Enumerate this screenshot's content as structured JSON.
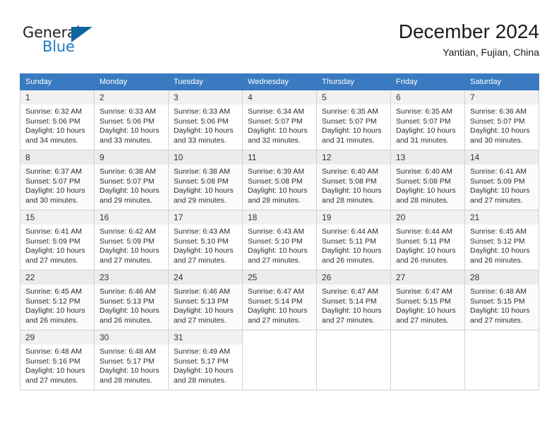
{
  "brand": {
    "name_part1": "General",
    "name_part2": "Blue",
    "triangle_color": "#10659f",
    "blue_color": "#1f7bc1"
  },
  "header": {
    "title": "December 2024",
    "subtitle": "Yantian, Fujian, China"
  },
  "theme": {
    "header_bg": "#3a7ac0",
    "header_text": "#ffffff",
    "cell_border": "#d2d2d2",
    "daynum_bg": "#f1f1f1"
  },
  "weekdays": [
    "Sunday",
    "Monday",
    "Tuesday",
    "Wednesday",
    "Thursday",
    "Friday",
    "Saturday"
  ],
  "labels": {
    "sunrise_prefix": "Sunrise:",
    "sunset_prefix": "Sunset:",
    "daylight_prefix": "Daylight:"
  },
  "weeks": [
    [
      {
        "day": "1",
        "sunrise": "Sunrise: 6:32 AM",
        "sunset": "Sunset: 5:06 PM",
        "daylight": "Daylight: 10 hours and 34 minutes."
      },
      {
        "day": "2",
        "sunrise": "Sunrise: 6:33 AM",
        "sunset": "Sunset: 5:06 PM",
        "daylight": "Daylight: 10 hours and 33 minutes."
      },
      {
        "day": "3",
        "sunrise": "Sunrise: 6:33 AM",
        "sunset": "Sunset: 5:06 PM",
        "daylight": "Daylight: 10 hours and 33 minutes."
      },
      {
        "day": "4",
        "sunrise": "Sunrise: 6:34 AM",
        "sunset": "Sunset: 5:07 PM",
        "daylight": "Daylight: 10 hours and 32 minutes."
      },
      {
        "day": "5",
        "sunrise": "Sunrise: 6:35 AM",
        "sunset": "Sunset: 5:07 PM",
        "daylight": "Daylight: 10 hours and 31 minutes."
      },
      {
        "day": "6",
        "sunrise": "Sunrise: 6:35 AM",
        "sunset": "Sunset: 5:07 PM",
        "daylight": "Daylight: 10 hours and 31 minutes."
      },
      {
        "day": "7",
        "sunrise": "Sunrise: 6:36 AM",
        "sunset": "Sunset: 5:07 PM",
        "daylight": "Daylight: 10 hours and 30 minutes."
      }
    ],
    [
      {
        "day": "8",
        "sunrise": "Sunrise: 6:37 AM",
        "sunset": "Sunset: 5:07 PM",
        "daylight": "Daylight: 10 hours and 30 minutes."
      },
      {
        "day": "9",
        "sunrise": "Sunrise: 6:38 AM",
        "sunset": "Sunset: 5:07 PM",
        "daylight": "Daylight: 10 hours and 29 minutes."
      },
      {
        "day": "10",
        "sunrise": "Sunrise: 6:38 AM",
        "sunset": "Sunset: 5:08 PM",
        "daylight": "Daylight: 10 hours and 29 minutes."
      },
      {
        "day": "11",
        "sunrise": "Sunrise: 6:39 AM",
        "sunset": "Sunset: 5:08 PM",
        "daylight": "Daylight: 10 hours and 28 minutes."
      },
      {
        "day": "12",
        "sunrise": "Sunrise: 6:40 AM",
        "sunset": "Sunset: 5:08 PM",
        "daylight": "Daylight: 10 hours and 28 minutes."
      },
      {
        "day": "13",
        "sunrise": "Sunrise: 6:40 AM",
        "sunset": "Sunset: 5:08 PM",
        "daylight": "Daylight: 10 hours and 28 minutes."
      },
      {
        "day": "14",
        "sunrise": "Sunrise: 6:41 AM",
        "sunset": "Sunset: 5:09 PM",
        "daylight": "Daylight: 10 hours and 27 minutes."
      }
    ],
    [
      {
        "day": "15",
        "sunrise": "Sunrise: 6:41 AM",
        "sunset": "Sunset: 5:09 PM",
        "daylight": "Daylight: 10 hours and 27 minutes."
      },
      {
        "day": "16",
        "sunrise": "Sunrise: 6:42 AM",
        "sunset": "Sunset: 5:09 PM",
        "daylight": "Daylight: 10 hours and 27 minutes."
      },
      {
        "day": "17",
        "sunrise": "Sunrise: 6:43 AM",
        "sunset": "Sunset: 5:10 PM",
        "daylight": "Daylight: 10 hours and 27 minutes."
      },
      {
        "day": "18",
        "sunrise": "Sunrise: 6:43 AM",
        "sunset": "Sunset: 5:10 PM",
        "daylight": "Daylight: 10 hours and 27 minutes."
      },
      {
        "day": "19",
        "sunrise": "Sunrise: 6:44 AM",
        "sunset": "Sunset: 5:11 PM",
        "daylight": "Daylight: 10 hours and 26 minutes."
      },
      {
        "day": "20",
        "sunrise": "Sunrise: 6:44 AM",
        "sunset": "Sunset: 5:11 PM",
        "daylight": "Daylight: 10 hours and 26 minutes."
      },
      {
        "day": "21",
        "sunrise": "Sunrise: 6:45 AM",
        "sunset": "Sunset: 5:12 PM",
        "daylight": "Daylight: 10 hours and 26 minutes."
      }
    ],
    [
      {
        "day": "22",
        "sunrise": "Sunrise: 6:45 AM",
        "sunset": "Sunset: 5:12 PM",
        "daylight": "Daylight: 10 hours and 26 minutes."
      },
      {
        "day": "23",
        "sunrise": "Sunrise: 6:46 AM",
        "sunset": "Sunset: 5:13 PM",
        "daylight": "Daylight: 10 hours and 26 minutes."
      },
      {
        "day": "24",
        "sunrise": "Sunrise: 6:46 AM",
        "sunset": "Sunset: 5:13 PM",
        "daylight": "Daylight: 10 hours and 27 minutes."
      },
      {
        "day": "25",
        "sunrise": "Sunrise: 6:47 AM",
        "sunset": "Sunset: 5:14 PM",
        "daylight": "Daylight: 10 hours and 27 minutes."
      },
      {
        "day": "26",
        "sunrise": "Sunrise: 6:47 AM",
        "sunset": "Sunset: 5:14 PM",
        "daylight": "Daylight: 10 hours and 27 minutes."
      },
      {
        "day": "27",
        "sunrise": "Sunrise: 6:47 AM",
        "sunset": "Sunset: 5:15 PM",
        "daylight": "Daylight: 10 hours and 27 minutes."
      },
      {
        "day": "28",
        "sunrise": "Sunrise: 6:48 AM",
        "sunset": "Sunset: 5:15 PM",
        "daylight": "Daylight: 10 hours and 27 minutes."
      }
    ],
    [
      {
        "day": "29",
        "sunrise": "Sunrise: 6:48 AM",
        "sunset": "Sunset: 5:16 PM",
        "daylight": "Daylight: 10 hours and 27 minutes."
      },
      {
        "day": "30",
        "sunrise": "Sunrise: 6:48 AM",
        "sunset": "Sunset: 5:17 PM",
        "daylight": "Daylight: 10 hours and 28 minutes."
      },
      {
        "day": "31",
        "sunrise": "Sunrise: 6:49 AM",
        "sunset": "Sunset: 5:17 PM",
        "daylight": "Daylight: 10 hours and 28 minutes."
      },
      {
        "day": "",
        "sunrise": "",
        "sunset": "",
        "daylight": ""
      },
      {
        "day": "",
        "sunrise": "",
        "sunset": "",
        "daylight": ""
      },
      {
        "day": "",
        "sunrise": "",
        "sunset": "",
        "daylight": ""
      },
      {
        "day": "",
        "sunrise": "",
        "sunset": "",
        "daylight": ""
      }
    ]
  ]
}
